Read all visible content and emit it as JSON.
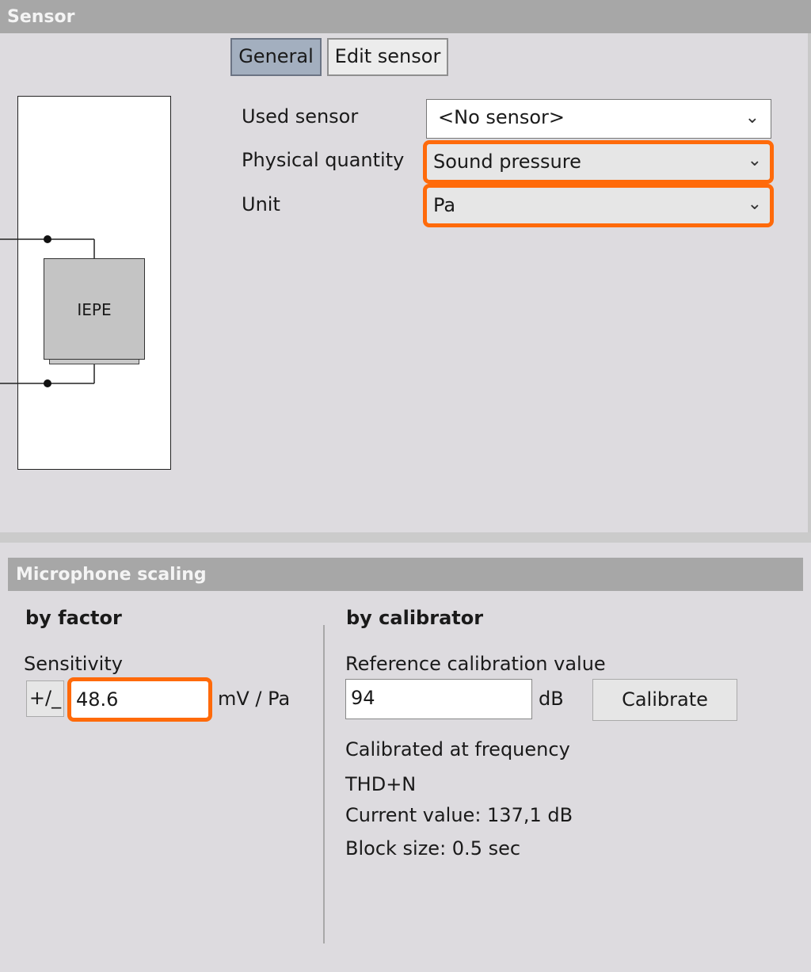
{
  "sensor": {
    "header": "Sensor",
    "tabs": {
      "general": "General",
      "edit_sensor": "Edit sensor"
    },
    "diagram": {
      "block_label": "IEPE"
    },
    "fields": {
      "used_sensor": {
        "label": "Used sensor",
        "value": "<No sensor>"
      },
      "physical_quantity": {
        "label": "Physical quantity",
        "value": "Sound pressure"
      },
      "unit": {
        "label": "Unit",
        "value": "Pa"
      }
    }
  },
  "microphone_scaling": {
    "header": "Microphone scaling",
    "by_factor": {
      "title": "by factor",
      "sensitivity_label": "Sensitivity",
      "sign_button": "+/_",
      "sensitivity_value": "48.6",
      "unit": "mV / Pa"
    },
    "by_calibrator": {
      "title": "by calibrator",
      "reference_label": "Reference calibration value",
      "reference_value": "94",
      "reference_unit": "dB",
      "calibrate_button": "Calibrate",
      "calibrated_at_frequency": "Calibrated at frequency",
      "thd_n": "THD+N",
      "current_value": "Current value: 137,1 dB",
      "block_size": "Block size: 0.5 sec"
    }
  },
  "colors": {
    "highlight": "#ff6a0a",
    "header_bg": "#a7a7a7",
    "panel_bg": "#dddbdf",
    "active_tab": "#a3afbf"
  },
  "icons": {
    "dropdown": "chevron-down-icon"
  }
}
